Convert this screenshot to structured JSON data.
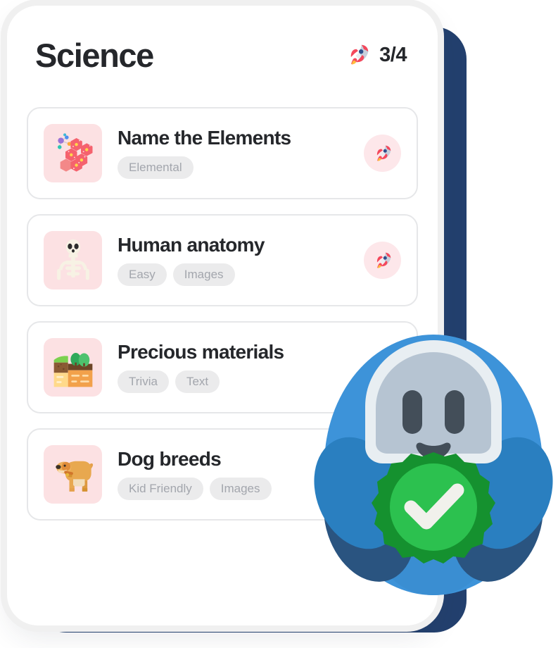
{
  "theme": {
    "page_background": "transparent",
    "panel_background": "#ffffff",
    "backing_panel": "#23406e",
    "title_color": "#25272b",
    "tag_background": "#ebebec",
    "tag_text": "#a3a6ad",
    "thumb_background": "#fce1e3",
    "badge_background": "#fde7ea",
    "card_border": "#e6e7e9",
    "mascot_body": "#3d93d9",
    "mascot_arm": "#2a7fc0",
    "mascot_arm_shadow": "#2a5480",
    "mascot_face": "#b6c4d2",
    "mascot_face_rim": "#e8eef2",
    "mascot_feature": "#434e59",
    "check_badge_outer": "#15912f",
    "check_badge_inner": "#2cc14f",
    "check_mark": "#f1f1ec"
  },
  "header": {
    "title": "Science",
    "progress_icon": "rocket-icon",
    "progress_label": "3/4"
  },
  "quizzes": [
    {
      "title": "Name the Elements",
      "tags": [
        "Elemental"
      ],
      "thumbnail_icon": "molecule-hexagons-icon",
      "badge_icon": "rocket-icon",
      "has_badge": true
    },
    {
      "title": "Human anatomy",
      "tags": [
        "Easy",
        "Images"
      ],
      "thumbnail_icon": "skeleton-icon",
      "badge_icon": "rocket-icon",
      "has_badge": true
    },
    {
      "title": "Precious materials",
      "tags": [
        "Trivia",
        "Text"
      ],
      "thumbnail_icon": "geology-strata-icon",
      "badge_icon": "",
      "has_badge": false
    },
    {
      "title": "Dog breeds",
      "tags": [
        "Kid Friendly",
        "Images"
      ],
      "thumbnail_icon": "dog-icon",
      "badge_icon": "",
      "has_badge": false
    }
  ],
  "mascot": {
    "name": "robot-mascot",
    "expression": "smiling",
    "held_item": "green-check-badge"
  }
}
